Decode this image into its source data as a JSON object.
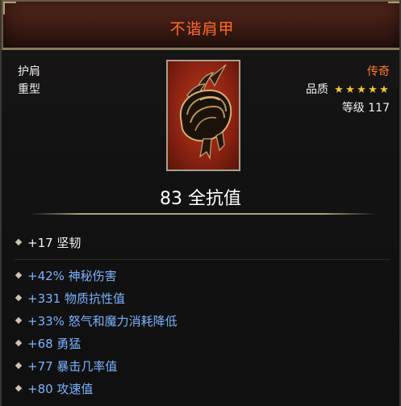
{
  "item": {
    "name": "不谐肩甲",
    "slot": "护肩",
    "weight": "重型",
    "rarity": "传奇",
    "quality_label": "品质",
    "quality_stars": [
      "★",
      "★",
      "★",
      "★",
      "★"
    ],
    "level_label": "等级",
    "level": "117",
    "resist_text": "83 全抗值",
    "base_stat": "+17 坚韧",
    "affixes": [
      "+42% 神秘伤害",
      "+331 物质抗性值",
      "+33% 怒气和魔力消耗降低",
      "+68 勇猛",
      "+77 暴击几率值",
      "+80 攻速值"
    ]
  },
  "colors": {
    "title": "#ff6a2a",
    "rarity": "#ff7a2e",
    "stars": "#f5c82d",
    "magic_affix": "#7ab2ff",
    "base_stat": "#f2f2f2",
    "icon_background": "#9a2a16"
  },
  "icons": {
    "item_icon": "pauldron-icon",
    "bullet": "diamond-bullet-icon"
  }
}
